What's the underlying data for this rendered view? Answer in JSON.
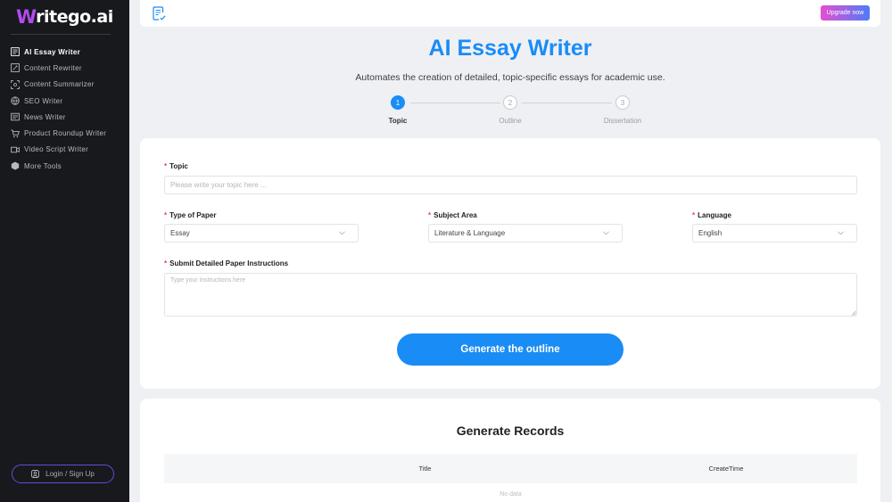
{
  "brand": {
    "logo_w": "W",
    "logo_rest": "ritego.ai"
  },
  "sidebar": {
    "items": [
      {
        "label": "AI Essay Writer",
        "icon": "essay-icon",
        "active": true
      },
      {
        "label": "Content Rewriter",
        "icon": "rewrite-icon"
      },
      {
        "label": "Content Summarizer",
        "icon": "summarize-icon"
      },
      {
        "label": "SEO Writer",
        "icon": "seo-icon"
      },
      {
        "label": "News Writer",
        "icon": "news-icon"
      },
      {
        "label": "Product Roundup Writer",
        "icon": "cart-icon"
      },
      {
        "label": "Video Script Writer",
        "icon": "video-icon"
      },
      {
        "label": "More Tools",
        "icon": "cube-icon"
      }
    ],
    "login_label": "Login / Sign Up"
  },
  "topbar": {
    "upgrade_label": "Upgrade now"
  },
  "header": {
    "title": "AI Essay Writer",
    "subtitle": "Automates the creation of detailed, topic-specific essays for academic use."
  },
  "steps": [
    {
      "number": "1",
      "label": "Topic",
      "active": true
    },
    {
      "number": "2",
      "label": "Outline"
    },
    {
      "number": "3",
      "label": "Dissertation"
    }
  ],
  "form": {
    "required_mark": "*",
    "topic": {
      "label": "Topic",
      "placeholder": "Please write your topic here ..."
    },
    "paper_type": {
      "label": "Type of Paper",
      "value": "Essay"
    },
    "subject": {
      "label": "Subject Area",
      "value": "Literature & Language"
    },
    "language": {
      "label": "Language",
      "value": "English"
    },
    "instructions": {
      "label": "Submit Detailed Paper Instructions",
      "placeholder": "Type your instructions here"
    },
    "generate_label": "Generate the outline"
  },
  "records": {
    "title": "Generate Records",
    "columns": [
      "Title",
      "CreateTime"
    ],
    "empty_text": "No data"
  },
  "colors": {
    "accent": "#1a8cf5",
    "sidebar_bg": "#18191d",
    "brand_purple": "#b04cf0",
    "required": "#e34646"
  }
}
